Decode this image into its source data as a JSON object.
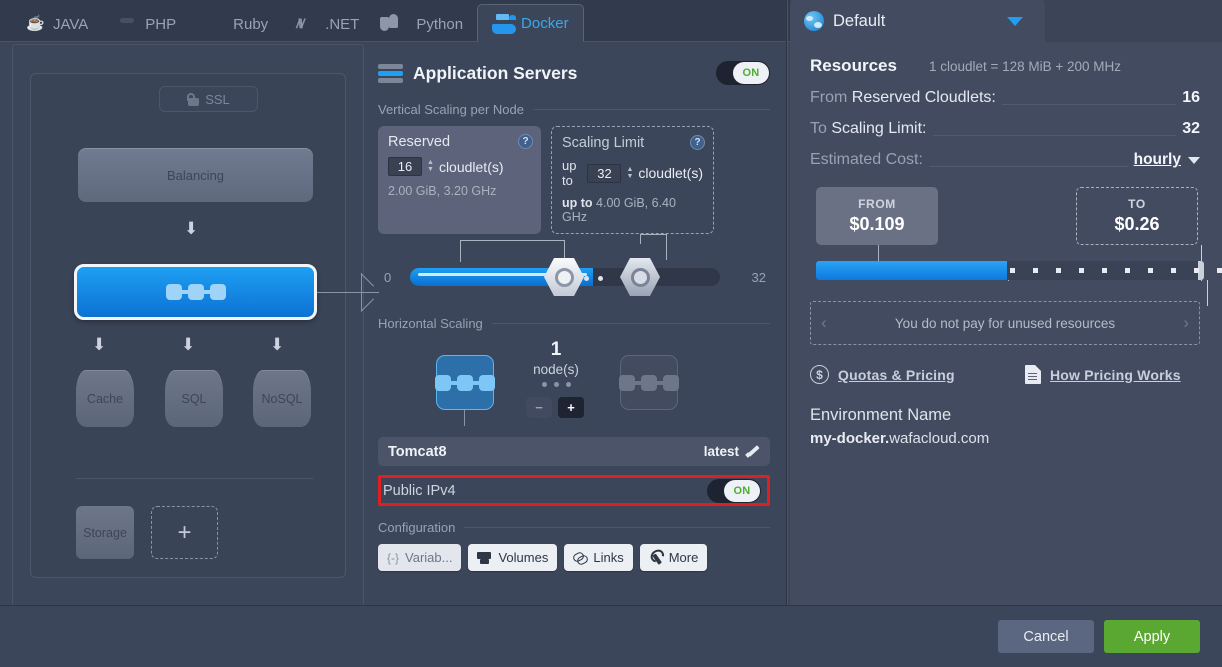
{
  "tabs": [
    {
      "label": "JAVA",
      "icon": "java-icon",
      "active": false
    },
    {
      "label": "PHP",
      "icon": "php-icon",
      "active": false
    },
    {
      "label": "Ruby",
      "icon": "ruby-icon",
      "active": false
    },
    {
      "label": ".NET",
      "icon": "dotnet-icon",
      "active": false
    },
    {
      "label": "Python",
      "icon": "python-icon",
      "active": false
    },
    {
      "label": "Docker",
      "icon": "docker-icon",
      "active": true
    }
  ],
  "window": {
    "close_label": "✕"
  },
  "topology": {
    "ssl_label": "SSL",
    "ssl_icon": "unlocked-padlock-icon",
    "balancing_label": "Balancing",
    "app_node_icon": "app-server-chain-icon",
    "db_nodes": [
      "Cache",
      "SQL",
      "NoSQL"
    ],
    "storage_label": "Storage",
    "add_label": "+"
  },
  "middle": {
    "title": "Application Servers",
    "title_icon": "server-stack-icon",
    "power_toggle": "ON",
    "vertical_section_label": "Vertical Scaling per Node",
    "reserved": {
      "title": "Reserved",
      "value": "16",
      "unit": "cloudlet(s)",
      "summary": "2.00 GiB, 3.20 GHz",
      "help_icon": "question-mark-icon"
    },
    "scaling_limit": {
      "title": "Scaling Limit",
      "prefix": "up to",
      "value": "32",
      "unit": "cloudlet(s)",
      "summary_prefix": "up to",
      "summary": "4.00 GiB, 6.40 GHz",
      "help_icon": "question-mark-icon"
    },
    "slider": {
      "min": "0",
      "max": "32",
      "from": 16,
      "to": 32
    },
    "horizontal_section_label": "Horizontal Scaling",
    "nodes": {
      "count": "1",
      "unit": "node(s)",
      "minus": "−",
      "plus": "+"
    },
    "image": {
      "name": "Tomcat8",
      "tag": "latest",
      "edit_icon": "pencil-icon"
    },
    "public_ipv4": {
      "label": "Public IPv4",
      "toggle": "ON"
    },
    "configuration_label": "Configuration",
    "config_buttons": [
      {
        "label": "Variab...",
        "icon": "braces-icon"
      },
      {
        "label": "Volumes",
        "icon": "volumes-icon"
      },
      {
        "label": "Links",
        "icon": "link-icon"
      },
      {
        "label": "More",
        "icon": "wrench-icon"
      }
    ]
  },
  "right": {
    "tab_title": "Default",
    "tab_icon": "globe-icon",
    "dropdown_icon": "caret-down-icon",
    "resources_title": "Resources",
    "resources_note": "1 cloudlet = 128 MiB + 200 MHz",
    "rows": [
      {
        "prefix": "From ",
        "key": "Reserved Cloudlets:",
        "value": "16"
      },
      {
        "prefix": "To ",
        "key": "Scaling Limit:",
        "value": "32"
      }
    ],
    "cost_label": "Estimated Cost:",
    "cost_period": "hourly",
    "price_from": {
      "caption": "FROM",
      "amount": "$0.109"
    },
    "price_to": {
      "caption": "TO",
      "amount": "$0.26"
    },
    "notice": "You do not pay for unused resources",
    "notice_prev": "‹",
    "notice_next": "›",
    "links": [
      {
        "label": "Quotas & Pricing",
        "icon": "dollar-circle-icon"
      },
      {
        "label": "How Pricing Works",
        "icon": "document-icon"
      }
    ],
    "env_name_label": "Environment Name",
    "env_name_value": "my-docker.",
    "env_domain": "wafacloud.com"
  },
  "footer": {
    "cancel": "Cancel",
    "apply": "Apply"
  },
  "colors": {
    "accent_blue": "#1e9ff2",
    "apply_green": "#5aa832",
    "alert_red": "#e02020",
    "panel_bg": "#3c465a",
    "right_panel_bg": "#424b60"
  }
}
